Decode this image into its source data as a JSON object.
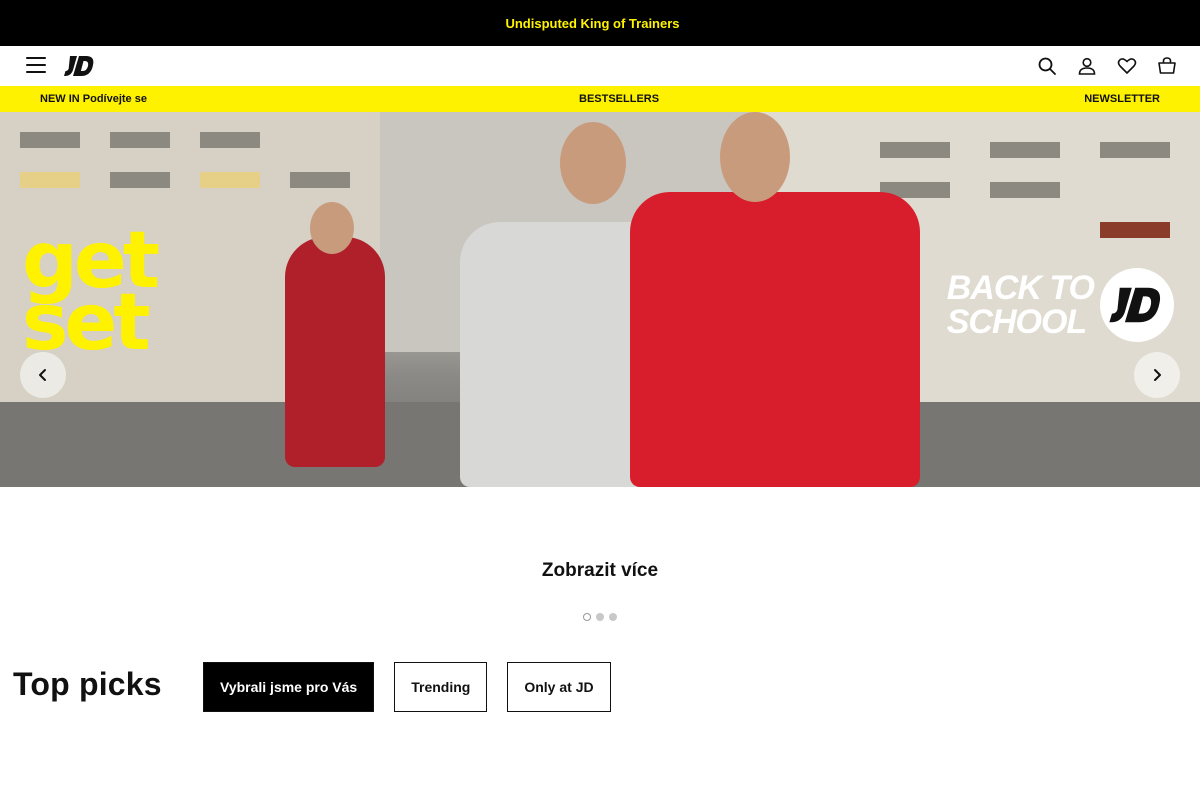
{
  "promo": {
    "text": "Undisputed King of Trainers"
  },
  "nav": {
    "logo_text": "JD",
    "icons": [
      "menu-icon",
      "search-icon",
      "user-icon",
      "heart-icon",
      "basket-icon"
    ]
  },
  "usp": {
    "left": "NEW IN Podívejte se",
    "middle": "BESTSELLERS",
    "right": "NEWSLETTER"
  },
  "hero": {
    "headline_line1": "get",
    "headline_line2": "set",
    "campaign_line1": "BACK TO",
    "campaign_line2": "SCHOOL",
    "badge_text": "JD",
    "accent_color": "#fff200"
  },
  "carousel": {
    "more_label": "Zobrazit více",
    "slides_total": 3,
    "active_slide": 1
  },
  "top_picks": {
    "title": "Top picks",
    "tabs": [
      {
        "label": "Vybrali jsme pro Vás",
        "active": true
      },
      {
        "label": "Trending",
        "active": false
      },
      {
        "label": "Only at JD",
        "active": false
      }
    ]
  }
}
